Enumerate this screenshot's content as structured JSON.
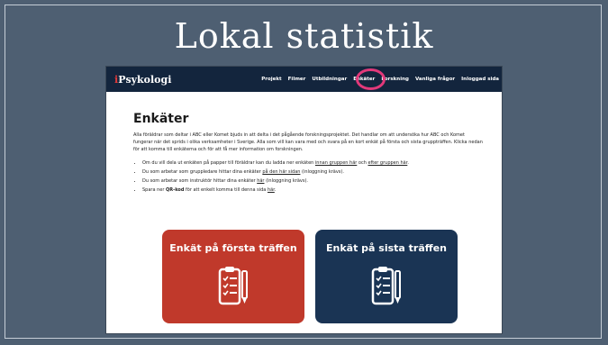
{
  "slide": {
    "title": "Lokal statistik"
  },
  "site": {
    "logo_prefix": "i",
    "logo_text": "Psykologi",
    "nav": [
      "Projekt",
      "Filmer",
      "Utbildningar",
      "Enkäter",
      "Forskning",
      "Vanliga frågor",
      "Inloggad sida"
    ],
    "active_nav": "Enkäter"
  },
  "page": {
    "heading": "Enkäter",
    "intro": "Alla föräldrar som deltar i ABC eller Komet bjuds in att delta i det pågående forskningsprojektet. Det handlar om att undersöka hur ABC och Komet fungerar när det sprids i olika verksamheter i Sverige. Alla som vill kan vara med och svara på en kort enkät på första och sista gruppträffen. Klicka nedan för att komma till enkäterna och för att få mer information om forskningen.",
    "bullets": [
      {
        "pre": "Om du vill dela ut enkäten på papper till föräldrar kan du ladda ner enkäten ",
        "link1": "innan gruppen här",
        "mid": " och ",
        "link2": "efter gruppen här",
        "post": "."
      },
      {
        "pre": "Du som arbetar som gruppledare hittar dina enkäter ",
        "link1": "på den här sidan",
        "post": " (inloggning krävs)."
      },
      {
        "pre": "Du som arbetar som instruktör hittar dina enkäter ",
        "link1": "här",
        "post": " (inloggning krävs)."
      },
      {
        "pre": "Spara ner ",
        "bold": "QR-kod",
        "mid": " för att enkelt komma till denna sida ",
        "link1": "här",
        "post": "."
      }
    ]
  },
  "cards": [
    {
      "label": "Enkät på första träffen",
      "color": "#c0392b",
      "icon": "clipboard-checklist-icon"
    },
    {
      "label": "Enkät på sista träffen",
      "color": "#1a3454",
      "icon": "clipboard-checklist-icon"
    }
  ]
}
